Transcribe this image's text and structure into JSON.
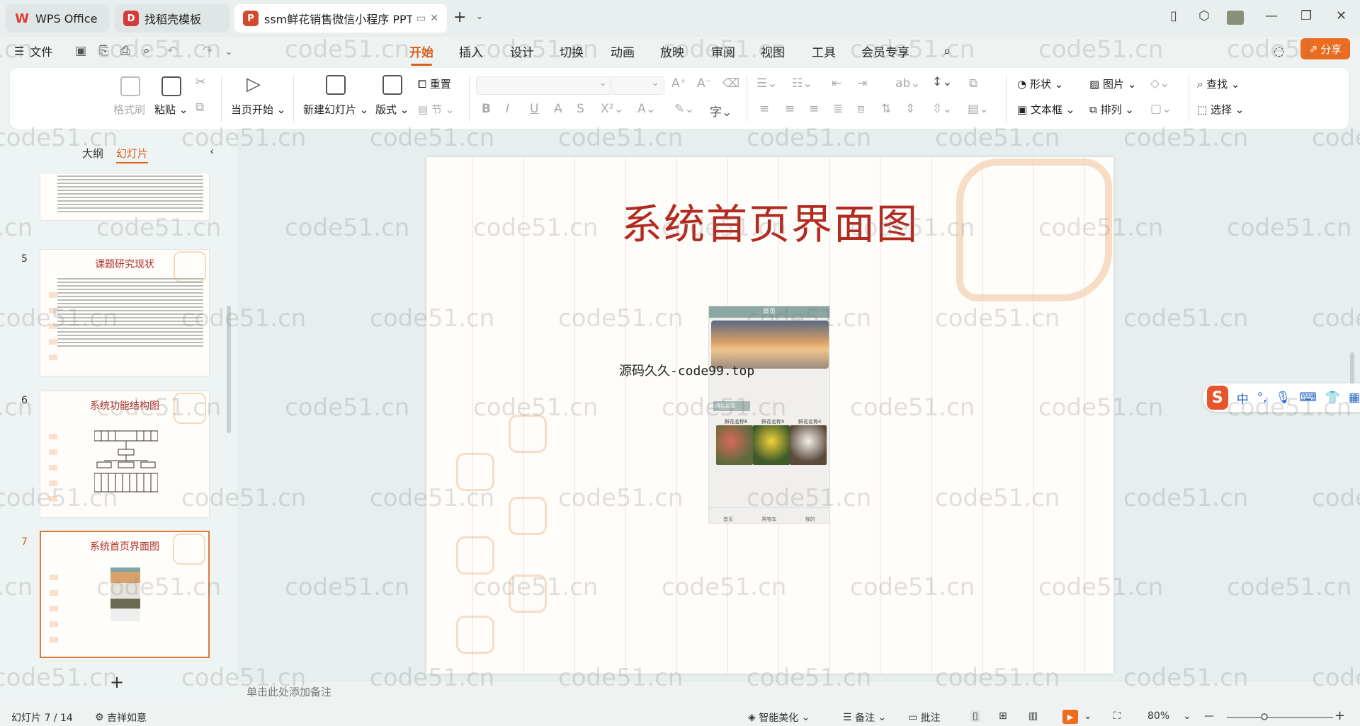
{
  "titlebar": {
    "tabs": [
      {
        "label": "WPS Office",
        "icon": "wps-logo-icon"
      },
      {
        "label": "找稻壳模板",
        "icon": "docer-icon"
      },
      {
        "label": "ssm鲜花销售微信小程序 PPT.p",
        "icon": "ppt-file-icon"
      }
    ]
  },
  "menubar": {
    "file_label": "文件",
    "tabs": [
      "开始",
      "插入",
      "设计",
      "切换",
      "动画",
      "放映",
      "审阅",
      "视图",
      "工具",
      "会员专享"
    ],
    "active_tab": "开始",
    "share_label": "分享"
  },
  "ribbon": {
    "format_painter": "格式刷",
    "paste": "粘贴",
    "start_from_current": "当页开始",
    "new_slide": "新建幻灯片",
    "layout": "版式",
    "reset": "重置",
    "section": "节",
    "shape": "形状",
    "picture": "图片",
    "text_box": "文本框",
    "arrange": "排列",
    "find": "查找",
    "select": "选择"
  },
  "leftpanel": {
    "tab_outline": "大纲",
    "tab_slides": "幻灯片",
    "thumbnails": [
      {
        "num": "5",
        "title": "课题研究现状"
      },
      {
        "num": "6",
        "title": "系统功能结构图"
      },
      {
        "num": "7",
        "title": "系统首页界面图",
        "active": true
      }
    ]
  },
  "slide": {
    "title": "系统首页界面图",
    "caption": "源码久久-code99.top",
    "phone": {
      "header": "首页",
      "section_label": "鲜花推荐",
      "items": [
        "鲜花名称6",
        "鲜花名称5",
        "鲜花名称4"
      ],
      "nav": [
        "首页",
        "购物车",
        "我的"
      ]
    }
  },
  "notes": {
    "placeholder": "单击此处添加备注"
  },
  "ime": {
    "lang": "中"
  },
  "watermark": "code51.cn",
  "statusbar": {
    "slide_counter": "幻灯片 7 / 14",
    "theme": "吉祥如意",
    "beautify": "智能美化",
    "notes": "备注",
    "comments": "批注",
    "zoom": "80%"
  },
  "colors": {
    "accent": "#d9601f",
    "share": "#ef6c1e",
    "slide_title": "#b32a1f"
  }
}
